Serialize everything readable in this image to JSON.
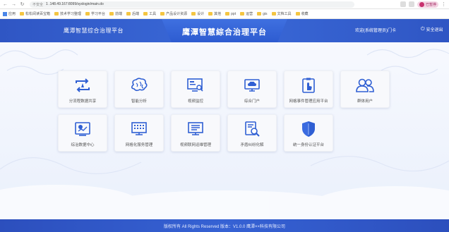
{
  "browser": {
    "nav": {
      "back": "←",
      "forward": "→",
      "reload": "↻"
    },
    "security": "不安全",
    "url": "1 .148.49.167:8099/syslogin/main.do",
    "profile": "已暂停",
    "menu": "⋮"
  },
  "bookmarks": [
    {
      "label": "应用",
      "type": "app"
    },
    {
      "label": "松松阅读百宝箱",
      "type": "folder"
    },
    {
      "label": "技术学习整理",
      "type": "folder"
    },
    {
      "label": "学习平台",
      "type": "folder"
    },
    {
      "label": "前端",
      "type": "folder"
    },
    {
      "label": "后端",
      "type": "folder"
    },
    {
      "label": "工具",
      "type": "folder"
    },
    {
      "label": "产品设计资源",
      "type": "folder"
    },
    {
      "label": "设计",
      "type": "folder"
    },
    {
      "label": "其他",
      "type": "folder"
    },
    {
      "label": "ppt",
      "type": "folder"
    },
    {
      "label": "运营",
      "type": "folder"
    },
    {
      "label": "gis",
      "type": "folder"
    },
    {
      "label": "文档工具",
      "type": "folder"
    },
    {
      "label": "收藏",
      "type": "folder"
    }
  ],
  "header": {
    "left_title": "鹰潭智慧综合治理平台",
    "center_title": "鹰潭智慧綜合治理平台",
    "user": "欢迎(系统管理员)门卡",
    "logout": "安全退出",
    "logout_icon": "power-icon"
  },
  "tiles": [
    {
      "label": "分流程数据共享",
      "icon": "exchange-icon",
      "color": "#2f5fd3"
    },
    {
      "label": "智能分析",
      "icon": "brain-icon",
      "color": "#2f5fd3"
    },
    {
      "label": "视频监控",
      "icon": "monitor-search-icon",
      "color": "#2f5fd3"
    },
    {
      "label": "综合门户",
      "icon": "cloud-screen-icon",
      "color": "#2f5fd3"
    },
    {
      "label": "网格事件管理应用平台",
      "icon": "touch-clipboard-icon",
      "color": "#2f5fd3"
    },
    {
      "label": "群体用户",
      "icon": "users-icon",
      "color": "#2f5fd3"
    },
    {
      "label": "综治数据中心",
      "icon": "data-analysis-icon",
      "color": "#2f5fd3"
    },
    {
      "label": "网格化服务管理",
      "icon": "grid-screen-icon",
      "color": "#2f5fd3"
    },
    {
      "label": "视频联网运维管理",
      "icon": "video-list-icon",
      "color": "#2f5fd3"
    },
    {
      "label": "矛盾纠纷化解",
      "icon": "doc-search-icon",
      "color": "#2f5fd3"
    },
    {
      "label": "统一身份认证平台",
      "icon": "shield-icon",
      "color": "#2f5fd3"
    }
  ],
  "footer": {
    "text": "版权所有 All Rights Reserved  版本：V1.0.0  鹰潭××科技有限公司"
  }
}
